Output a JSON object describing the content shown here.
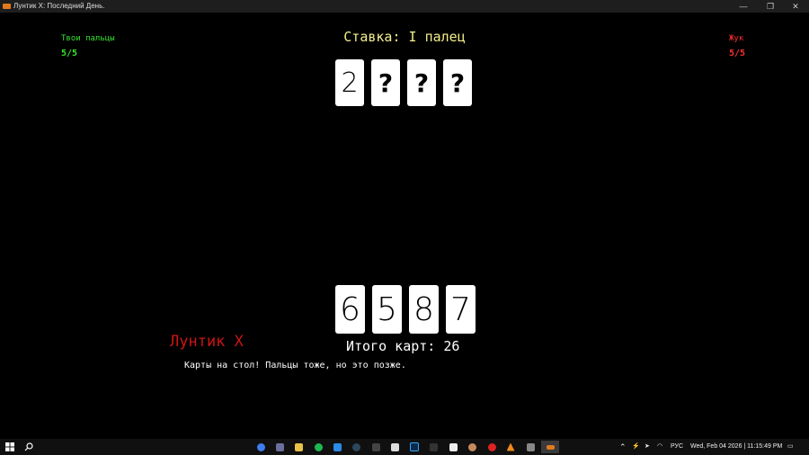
{
  "window": {
    "title": "Лунтик X: Последний День.",
    "min_glyph": "—",
    "max_glyph": "❐",
    "close_glyph": "✕"
  },
  "player": {
    "label": "Твои пальцы",
    "fingers": "5/5"
  },
  "opponent": {
    "label": "Жук",
    "fingers": "5/5"
  },
  "bet": "Ставка: I палец",
  "opponent_cards": [
    "2",
    "?",
    "?",
    "?"
  ],
  "player_cards": [
    "6",
    "5",
    "8",
    "7"
  ],
  "total_cards": "Итого карт: 26",
  "dialogue": {
    "speaker": "Лунтик X",
    "text": "Карты на стол! Пальцы тоже, но это позже."
  },
  "taskbar": {
    "language": "РУС",
    "datetime": "Wed, Feb 04 2026 | 11:15:49 PM",
    "colors": {
      "accent_active": "#e07a1f"
    }
  }
}
